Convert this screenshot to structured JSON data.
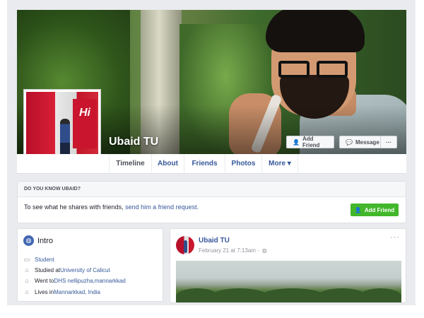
{
  "profile": {
    "name": "Ubaid TU",
    "profile_sign_text": "Hi",
    "cover_buttons": {
      "add_friend": "Add Friend",
      "message": "Message",
      "more": "···"
    }
  },
  "tabs": [
    {
      "label": "Timeline",
      "active": true
    },
    {
      "label": "About",
      "active": false
    },
    {
      "label": "Friends",
      "active": false
    },
    {
      "label": "Photos",
      "active": false
    },
    {
      "label": "More ▾",
      "active": false
    }
  ],
  "know_box": {
    "heading": "DO YOU KNOW UBAID?",
    "text": "To see what he shares with friends, ",
    "link": "send him a friend request.",
    "button": "Add Friend"
  },
  "intro": {
    "title": "Intro",
    "items": [
      {
        "icon": "briefcase-icon",
        "prefix": "",
        "link": "Student"
      },
      {
        "icon": "graduation-cap-icon",
        "prefix": "Studied at ",
        "link": "University of Calicut"
      },
      {
        "icon": "graduation-cap-icon",
        "prefix": "Went to ",
        "link": "DHS nellipuzha,mannarkkad"
      },
      {
        "icon": "home-icon",
        "prefix": "Lives in ",
        "link": "Mannarkkad, India"
      }
    ]
  },
  "post": {
    "author": "Ubaid TU",
    "time": "February 21 at 7:13am ·",
    "privacy_icon": "globe-icon",
    "more": "···"
  },
  "colors": {
    "link": "#365899",
    "green_button": "#42b72a",
    "page_bg": "#e9ebee"
  }
}
